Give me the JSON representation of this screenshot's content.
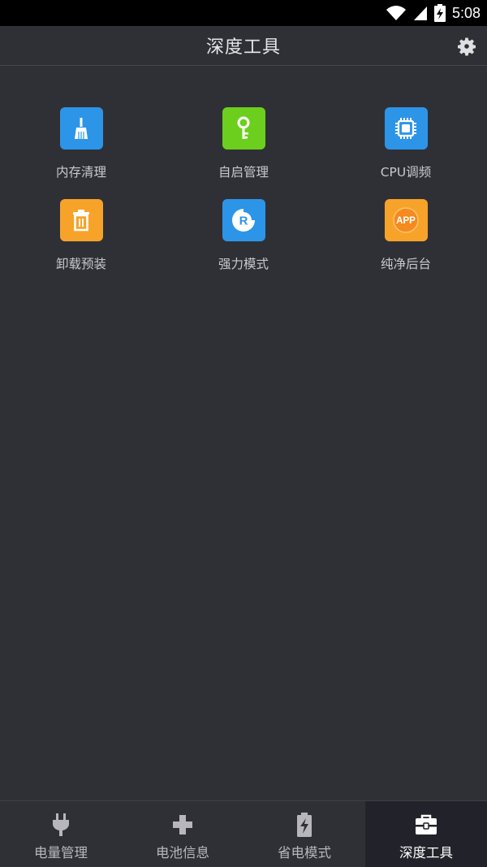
{
  "status_bar": {
    "time": "5:08",
    "icons": [
      "wifi-icon",
      "signal-icon",
      "battery-charging-icon"
    ]
  },
  "app_bar": {
    "title": "深度工具",
    "settings_icon": "gear-icon"
  },
  "tools": [
    {
      "label": "内存清理",
      "icon": "broom-icon",
      "color": "#2d95e8"
    },
    {
      "label": "自启管理",
      "icon": "key-icon",
      "color": "#6ccf1d"
    },
    {
      "label": "CPU调频",
      "icon": "chip-icon",
      "color": "#2d95e8"
    },
    {
      "label": "卸载预装",
      "icon": "trash-icon",
      "color": "#f7a32a"
    },
    {
      "label": "强力模式",
      "icon": "root-r-icon",
      "color": "#2d95e8"
    },
    {
      "label": "纯净后台",
      "icon": "app-badge-icon",
      "color": "#f7a32a",
      "icon_text": "APP"
    }
  ],
  "bottom_nav": {
    "items": [
      {
        "label": "电量管理",
        "icon": "plug-icon",
        "active": false
      },
      {
        "label": "电池信息",
        "icon": "plus-icon",
        "active": false
      },
      {
        "label": "省电模式",
        "icon": "battery-bolt-icon",
        "active": false
      },
      {
        "label": "深度工具",
        "icon": "toolbox-icon",
        "active": true
      }
    ]
  },
  "colors": {
    "background": "#2f3036",
    "status_bar": "#000000",
    "active_nav": "#22232a"
  }
}
